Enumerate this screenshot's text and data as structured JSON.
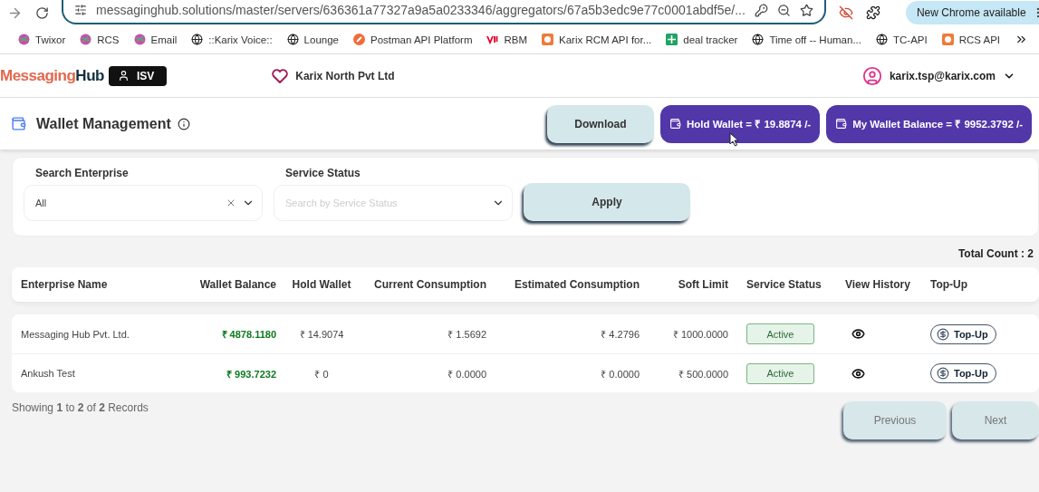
{
  "browser": {
    "url": "messaginghub.solutions/master/servers/636361a77327a9a5a0233346/aggregators/67a5b3edc9e77c0001abdf5e/...",
    "update_label": "New Chrome available",
    "bookmarks": [
      {
        "kind": "swirl",
        "label": "Twixor"
      },
      {
        "kind": "swirl",
        "label": "RCS"
      },
      {
        "kind": "swirl",
        "label": "Email"
      },
      {
        "kind": "globe",
        "label": "::Karix Voice::"
      },
      {
        "kind": "globe",
        "label": "Lounge"
      },
      {
        "kind": "postman",
        "label": "Postman API Platform"
      },
      {
        "kind": "vi",
        "label": "RBM"
      },
      {
        "kind": "doc",
        "label": "Karix RCM API for..."
      },
      {
        "kind": "sheet",
        "label": "deal tracker"
      },
      {
        "kind": "globe",
        "label": "Time off -- Human..."
      },
      {
        "kind": "globe",
        "label": "TC-API"
      },
      {
        "kind": "doc",
        "label": "RCS API"
      }
    ]
  },
  "header": {
    "brand_first": "Messaging",
    "brand_second": "Hub",
    "role": "ISV",
    "organization": "Karix North Pvt Ltd",
    "user": "karix.tsp@karix.com"
  },
  "page": {
    "title": "Wallet Management",
    "download": "Download",
    "hold_wallet": "Hold Wallet = ₹ 19.8874 /-",
    "wallet_balance": "My Wallet Balance = ₹ 9952.3792 /-"
  },
  "filters": {
    "fields": [
      {
        "label": "Search Enterprise",
        "value": "All"
      },
      {
        "label": "Service Status",
        "placeholder": "Search by Service Status"
      }
    ],
    "apply": "Apply"
  },
  "total_count": "Total Count : 2",
  "table": {
    "columns": [
      "Enterprise Name",
      "Wallet Balance",
      "Hold Wallet",
      "Current Consumption",
      "Estimated Consumption",
      "Soft Limit",
      "Service Status",
      "View History",
      "Top-Up"
    ],
    "rows": [
      {
        "name": "Messaging Hub Pvt. Ltd.",
        "wallet_balance": "₹ 4878.1180",
        "hold_wallet": "₹ 14.9074",
        "current": "₹ 1.5692",
        "estimated": "₹ 4.2796",
        "soft_limit": "₹ 1000.0000",
        "status": {
          "kind": "active",
          "label": "Active"
        },
        "topup": "Top-Up"
      },
      {
        "name": "Ankush Test",
        "wallet_balance": "₹ 993.7232",
        "hold_wallet": "₹ 0",
        "current": "₹ 0.0000",
        "estimated": "₹ 0.0000",
        "soft_limit": "₹ 500.0000",
        "status": {
          "kind": "active",
          "label": "Active"
        },
        "topup": "Top-Up"
      }
    ]
  },
  "footer": {
    "showing": "Showing **1** to **2** of **2** Records",
    "buttons": [
      {
        "label": "Previous",
        "disabled": true
      },
      {
        "label": "Next",
        "disabled": true
      }
    ]
  }
}
